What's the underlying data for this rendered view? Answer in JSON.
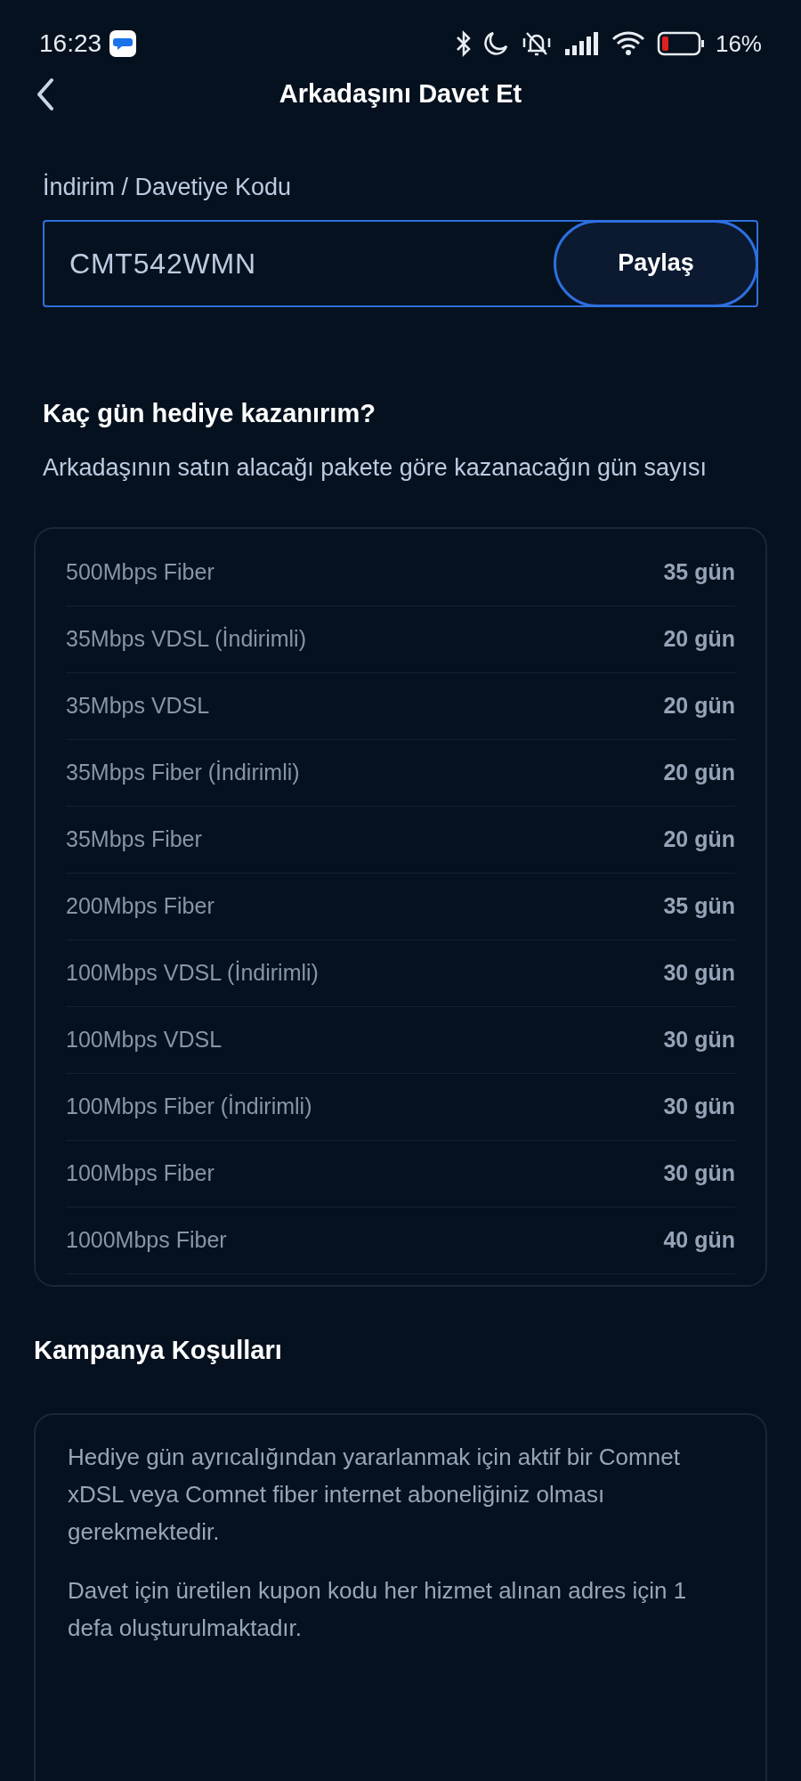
{
  "status_bar": {
    "time": "16:23",
    "battery_percent": "16%"
  },
  "header": {
    "title": "Arkadaşını Davet Et"
  },
  "code_field": {
    "label": "İndirim / Davetiye Kodu",
    "value": "CMT542WMN",
    "button": "Paylaş"
  },
  "rewards": {
    "heading": "Kaç gün hediye kazanırım?",
    "subtitle": "Arkadaşının satın alacağı pakete göre kazanacağın gün sayısı",
    "rows": [
      {
        "package": "500Mbps Fiber",
        "days": "35 gün"
      },
      {
        "package": "35Mbps VDSL (İndirimli)",
        "days": "20 gün"
      },
      {
        "package": "35Mbps VDSL",
        "days": "20 gün"
      },
      {
        "package": "35Mbps Fiber (İndirimli)",
        "days": "20 gün"
      },
      {
        "package": "35Mbps Fiber",
        "days": "20 gün"
      },
      {
        "package": "200Mbps Fiber",
        "days": "35 gün"
      },
      {
        "package": "100Mbps VDSL (İndirimli)",
        "days": "30 gün"
      },
      {
        "package": "100Mbps VDSL",
        "days": "30 gün"
      },
      {
        "package": "100Mbps Fiber (İndirimli)",
        "days": "30 gün"
      },
      {
        "package": "100Mbps Fiber",
        "days": "30 gün"
      },
      {
        "package": "1000Mbps Fiber",
        "days": "40 gün"
      }
    ]
  },
  "terms": {
    "heading": "Kampanya Koşulları",
    "paragraphs": [
      "Hediye gün ayrıcalığından yararlanmak için aktif bir Comnet xDSL veya Comnet fiber internet aboneliğiniz olması gerekmektedir.",
      "Davet için üretilen kupon kodu her hizmet alınan adres için 1 defa oluşturulmaktadır."
    ]
  }
}
